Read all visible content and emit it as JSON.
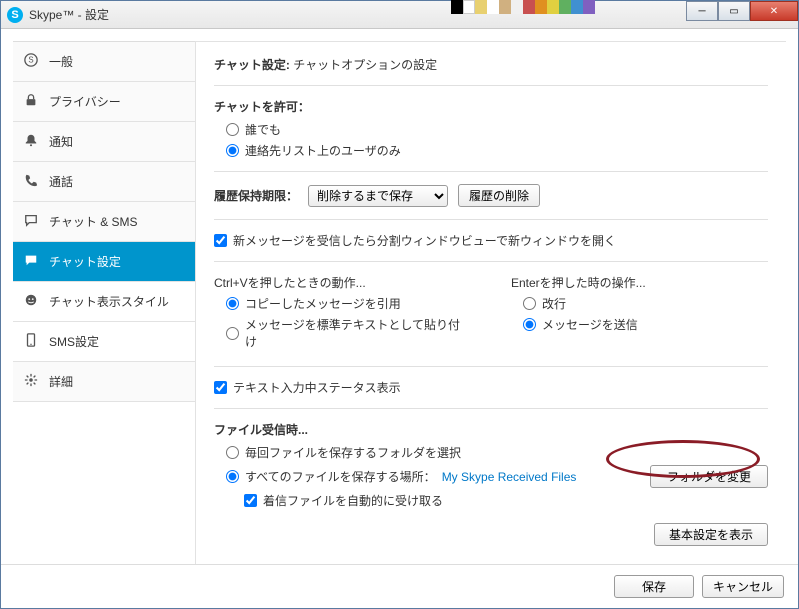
{
  "window": {
    "title": "Skype™ - 設定"
  },
  "sidebar": {
    "items": [
      {
        "label": "一般"
      },
      {
        "label": "プライバシー"
      },
      {
        "label": "通知"
      },
      {
        "label": "通話"
      },
      {
        "label": "チャット & SMS"
      },
      {
        "label": "チャット設定"
      },
      {
        "label": "チャット表示スタイル"
      },
      {
        "label": "SMS設定"
      },
      {
        "label": "詳細"
      }
    ]
  },
  "header": {
    "title": "チャット設定:",
    "subtitle": "チャットオプションの設定"
  },
  "allow": {
    "label": "チャットを許可：",
    "anyone": "誰でも",
    "contacts": "連絡先リスト上のユーザのみ"
  },
  "history": {
    "label": "履歴保持期限：",
    "selected": "削除するまで保存",
    "delete_btn": "履歴の削除"
  },
  "split": {
    "label": "新メッセージを受信したら分割ウィンドウビューで新ウィンドウを開く"
  },
  "ctrlv": {
    "label": "Ctrl+Vを押したときの動作...",
    "quote": "コピーしたメッセージを引用",
    "paste": "メッセージを標準テキストとして貼り付け"
  },
  "enter": {
    "label": "Enterを押した時の操作...",
    "newline": "改行",
    "send": "メッセージを送信"
  },
  "typing": {
    "label": "テキスト入力中ステータス表示"
  },
  "file": {
    "label": "ファイル受信時...",
    "choose": "毎回ファイルを保存するフォルダを選択",
    "saveall_prefix": "すべてのファイルを保存する場所：",
    "saveall_path": "My Skype Received Files",
    "change_btn": "フォルダを変更",
    "auto": "着信ファイルを自動的に受け取る"
  },
  "buttons": {
    "basic": "基本設定を表示",
    "save": "保存",
    "cancel": "キャンセル"
  }
}
